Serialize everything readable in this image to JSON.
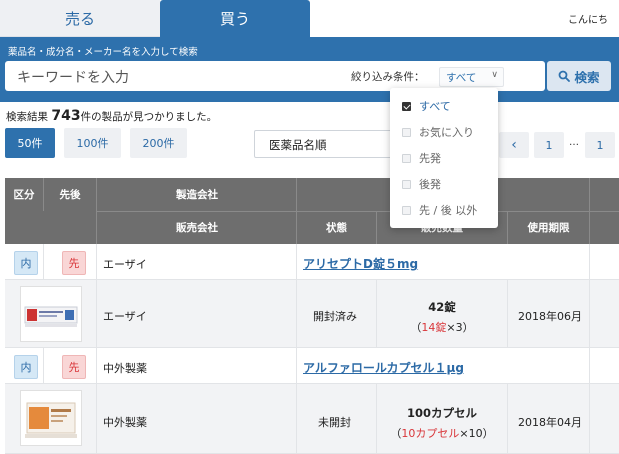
{
  "tabs": {
    "sell": "売る",
    "buy": "買う",
    "greeting": "こんにち"
  },
  "search": {
    "hint": "薬品名・成分名・メーカー名を入力して検索",
    "placeholder": "キーワードを入力",
    "filter_label": "絞り込み条件：",
    "filter_value": "すべて",
    "button_label": "検索"
  },
  "results": {
    "prefix": "検索結果",
    "count": "743",
    "suffix": "件の製品が見つかりました。"
  },
  "per_page": [
    "50件",
    "100件",
    "200件"
  ],
  "sort": {
    "value": "医薬品名順"
  },
  "pagination": {
    "prev": "‹",
    "first": "1",
    "dots": "…",
    "last": "1"
  },
  "table": {
    "headers": {
      "kubun": "区分",
      "sengo": "先後",
      "maker": "製造会社",
      "seller": "販売会社",
      "status": "状態",
      "quantity": "販売数量",
      "expiry": "使用期限"
    },
    "rows": [
      {
        "badge_in": "内",
        "badge_saki": "先",
        "maker": "エーザイ",
        "drug_name": "アリセプトD錠５mg",
        "seller": "エーザイ",
        "status": "開封済み",
        "qty_main": "42錠",
        "qty_open": "（",
        "qty_sub_red": "14錠",
        "qty_sub": "×3）",
        "expiry": "2018年06月"
      },
      {
        "badge_in": "内",
        "badge_saki": "先",
        "maker": "中外製薬",
        "drug_name": "アルファロールカプセル１μg",
        "seller": "中外製薬",
        "status": "未開封",
        "qty_main": "100カプセル",
        "qty_open": "（",
        "qty_sub_red": "10カプセル",
        "qty_sub": "×10）",
        "expiry": "2018年04月"
      }
    ]
  },
  "filter_dropdown": {
    "options": [
      {
        "label": "すべて",
        "checked": true
      },
      {
        "label": "お気に入り",
        "checked": false
      },
      {
        "label": "先発",
        "checked": false
      },
      {
        "label": "後発",
        "checked": false
      },
      {
        "label": "先 / 後 以外",
        "checked": false
      }
    ]
  },
  "colors": {
    "brand": "#2e71ad",
    "header_gray": "#6e6e6e",
    "accent_red": "#d9363a"
  }
}
